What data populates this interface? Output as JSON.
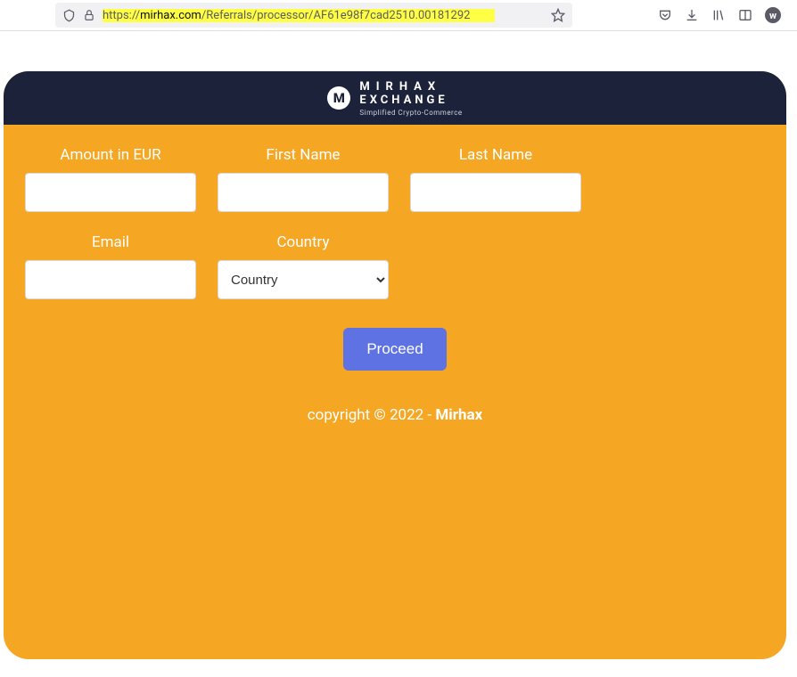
{
  "browser": {
    "url_proto": "https://",
    "url_domain": "mirhax.com",
    "url_path": "/Referrals/processor/AF61e98f7cad2510.00181292"
  },
  "logo": {
    "mark": "M",
    "line1": "MIRHAX",
    "line2": "EXCHANGE",
    "tagline": "Simplified Crypto-Commerce"
  },
  "form": {
    "amount_label": "Amount in EUR",
    "first_name_label": "First Name",
    "last_name_label": "Last Name",
    "email_label": "Email",
    "country_label": "Country",
    "country_placeholder": "Country",
    "proceed_label": "Proceed"
  },
  "footer": {
    "copyright_prefix": "copyright © 2022 - ",
    "brand": "Mirhax"
  },
  "toolbar_w": "w"
}
